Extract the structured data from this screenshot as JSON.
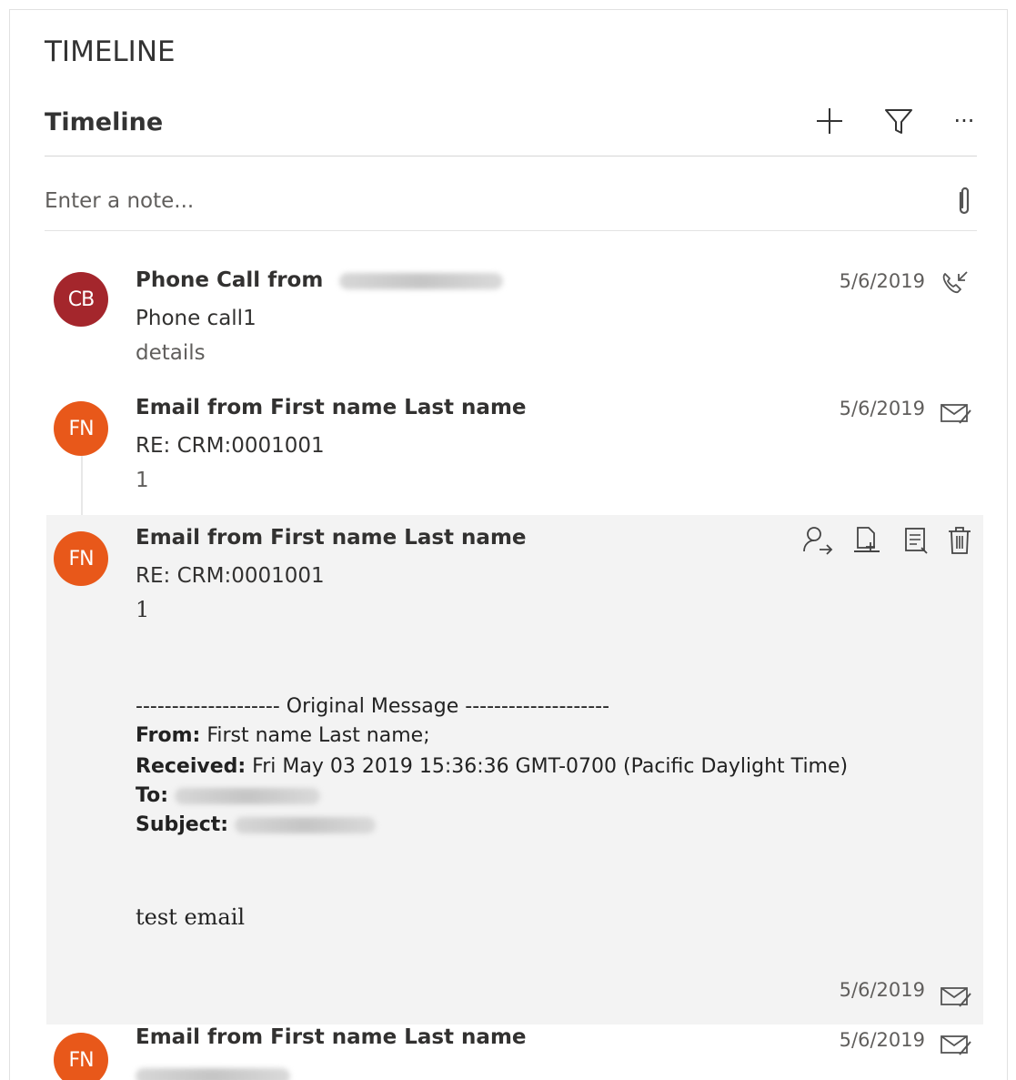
{
  "section_title": "TIMELINE",
  "header": {
    "title": "Timeline",
    "add_icon": "plus-icon",
    "filter_icon": "filter-icon",
    "more_icon": "more-icon",
    "more_label": "···"
  },
  "note": {
    "placeholder": "Enter a note...",
    "attach_icon": "paperclip-icon"
  },
  "items": [
    {
      "initials": "CB",
      "title": "Phone Call from",
      "subtitle": "Phone call1",
      "detail": "details",
      "date": "5/6/2019",
      "type_icon": "phone-call-icon",
      "avatar_color": "#a4262c"
    },
    {
      "initials": "FN",
      "title": "Email from First name Last name",
      "subtitle": "RE: CRM:0001001",
      "detail": "1",
      "date": "5/6/2019",
      "type_icon": "email-icon",
      "avatar_color": "#e8581a"
    },
    {
      "initials": "FN",
      "title": "Email from First name Last name",
      "subtitle": "RE: CRM:0001001",
      "detail": "1",
      "date": "5/6/2019",
      "type_icon": "email-icon",
      "avatar_color": "#e8581a",
      "actions": [
        "assign-icon",
        "add-to-queue-icon",
        "open-record-icon",
        "delete-icon"
      ],
      "message": {
        "separator": "-------------------- Original Message --------------------",
        "from_label": "From:",
        "from_value": "First name Last name;",
        "received_label": "Received:",
        "received_value": "Fri May 03 2019 15:36:36 GMT-0700 (Pacific Daylight Time)",
        "to_label": "To:",
        "subject_label": "Subject:",
        "body": "test email"
      }
    },
    {
      "initials": "FN",
      "title": "Email from First name Last name",
      "date": "5/6/2019",
      "type_icon": "email-icon",
      "avatar_color": "#e8581a"
    }
  ]
}
